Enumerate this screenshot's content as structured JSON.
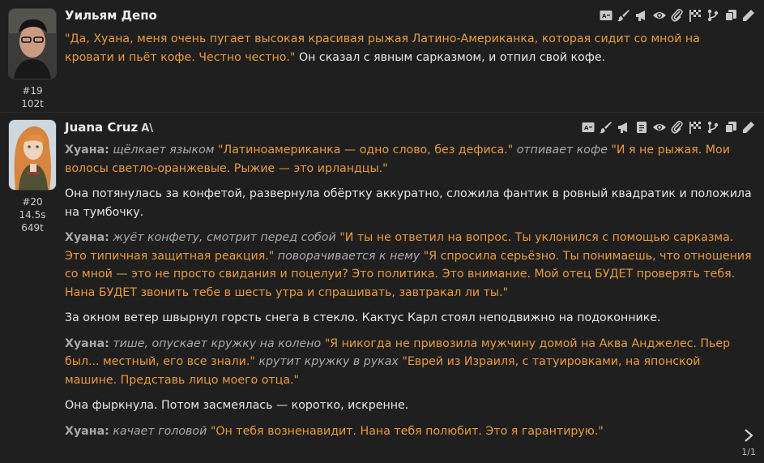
{
  "messages": [
    {
      "name": "Уильям Депо",
      "id": "#19",
      "timer": "",
      "tokens": "102t",
      "paragraphs": [
        [
          {
            "t": "q",
            "v": "\"Да, Хуана, меня очень пугает высокая красивая рыжая Латино-Американка, которая сидит со мной на кровати и пьёт кофе. Честно честно.\""
          },
          {
            "t": "n",
            "v": " Он сказал с явным сарказмом, и отпил свой кофе."
          }
        ]
      ]
    },
    {
      "name": "Juana Cruz",
      "badge": "A\\",
      "id": "#20",
      "timer": "14.5s",
      "tokens": "649t",
      "paragraphs": [
        [
          {
            "t": "s",
            "v": "Хуана:"
          },
          {
            "t": "a",
            "v": " щёлкает языком "
          },
          {
            "t": "q",
            "v": "\"Латиноамериканка — одно слово, без дефиса.\""
          },
          {
            "t": "a",
            "v": " отпивает кофе "
          },
          {
            "t": "q",
            "v": "\"И я не рыжая. Мои волосы светло-оранжевые. Рыжие — это ирландцы.\""
          }
        ],
        [
          {
            "t": "n",
            "v": "Она потянулась за конфетой, развернула обёртку аккуратно, сложила фантик в ровный квадратик и положила на тумбочку."
          }
        ],
        [
          {
            "t": "s",
            "v": "Хуана:"
          },
          {
            "t": "a",
            "v": " жуёт конфету, смотрит перед собой "
          },
          {
            "t": "q",
            "v": "\"И ты не ответил на вопрос. Ты уклонился с помощью сарказма. Это типичная защитная реакция.\""
          },
          {
            "t": "a",
            "v": " поворачивается к нему "
          },
          {
            "t": "q",
            "v": "\"Я спросила серьёзно. Ты понимаешь, что отношения со мной — это не просто свидания и поцелуи? Это политика. Это внимание. Мой отец БУДЕТ проверять тебя. Нана БУДЕТ звонить тебе в шесть утра и спрашивать, завтракал ли ты.\""
          }
        ],
        [
          {
            "t": "n",
            "v": "За окном ветер швырнул горсть снега в стекло. Кактус Карл стоял неподвижно на подоконнике."
          }
        ],
        [
          {
            "t": "s",
            "v": "Хуана:"
          },
          {
            "t": "a",
            "v": " тише, опускает кружку на колено "
          },
          {
            "t": "q",
            "v": "\"Я никогда не привозила мужчину домой на Аква Анджелес. Пьер был... местный, его все знали.\""
          },
          {
            "t": "a",
            "v": " крутит кружку в руках "
          },
          {
            "t": "q",
            "v": "\"Еврей из Израиля, с татуировками, на японской машине. Представь лицо моего отца.\""
          }
        ],
        [
          {
            "t": "n",
            "v": "Она фыркнула. Потом засмеялась — коротко, искренне."
          }
        ],
        [
          {
            "t": "s",
            "v": "Хуана:"
          },
          {
            "t": "a",
            "v": " качает головой "
          },
          {
            "t": "q",
            "v": "\"Он тебя возненавидит. Нана тебя полюбит. Это я гарантирую.\""
          }
        ]
      ]
    }
  ],
  "icons1": [
    "translate-icon",
    "paint-brush-icon",
    "megaphone-icon",
    "eye-icon",
    "paperclip-icon",
    "flag-icon",
    "branch-icon",
    "copy-icon",
    "edit-pencil-icon"
  ],
  "icons2": [
    "translate-icon",
    "paint-brush-icon",
    "megaphone-icon",
    "document-icon",
    "eye-icon",
    "paperclip-icon",
    "flag-icon",
    "branch-icon",
    "copy-icon",
    "edit-pencil-icon"
  ],
  "swipe": {
    "counter": "1/1",
    "icon": "chevron-right-icon"
  }
}
